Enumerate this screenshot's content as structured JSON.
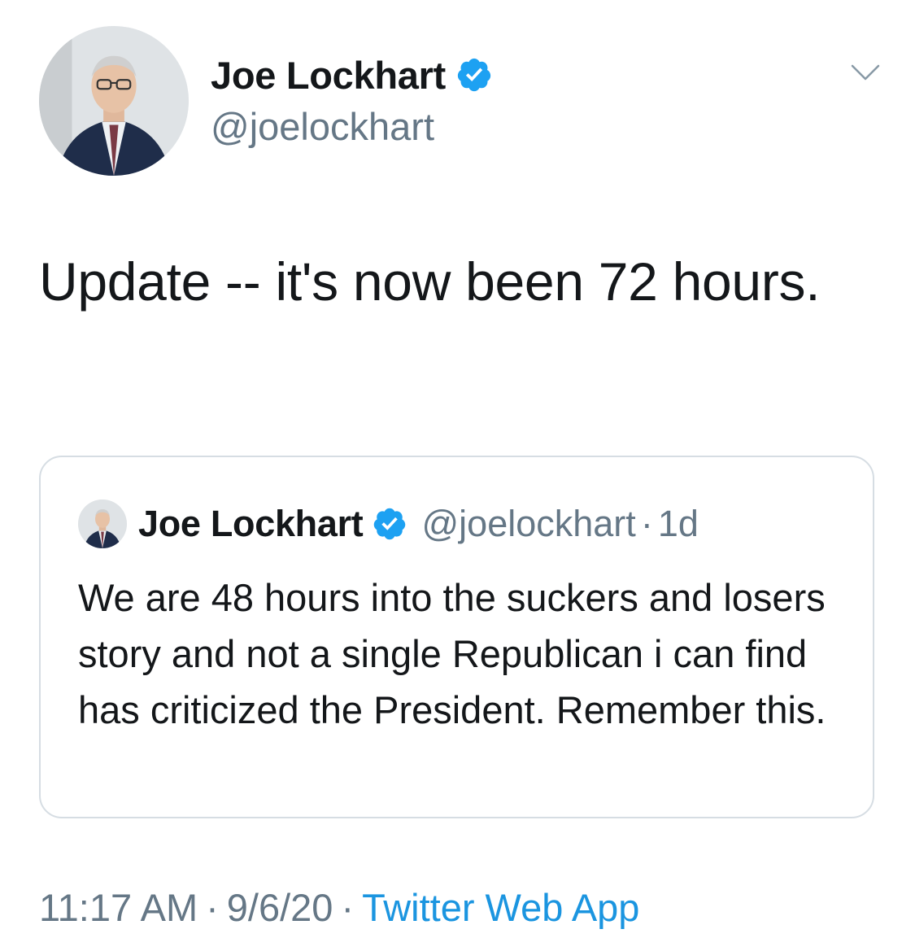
{
  "author": {
    "display_name": "Joe Lockhart",
    "handle": "@joelockhart",
    "verified": true
  },
  "tweet": {
    "text": "Update -- it's now been 72 hours."
  },
  "quoted_tweet": {
    "display_name": "Joe Lockhart",
    "handle": "@joelockhart",
    "separator": "·",
    "time": "1d",
    "text": "We are 48 hours into the suckers and losers story and not a single Republican i can find has criticized the President.  Remember this."
  },
  "meta": {
    "time": "11:17 AM",
    "separator": "·",
    "date": "9/6/20",
    "source": "Twitter Web App"
  },
  "colors": {
    "text_primary": "#14171a",
    "text_secondary": "#657786",
    "accent_blue": "#1b95e0",
    "border": "#d6dde3"
  },
  "icons": {
    "verified": "verified-badge-icon",
    "caret": "chevron-down-icon"
  }
}
